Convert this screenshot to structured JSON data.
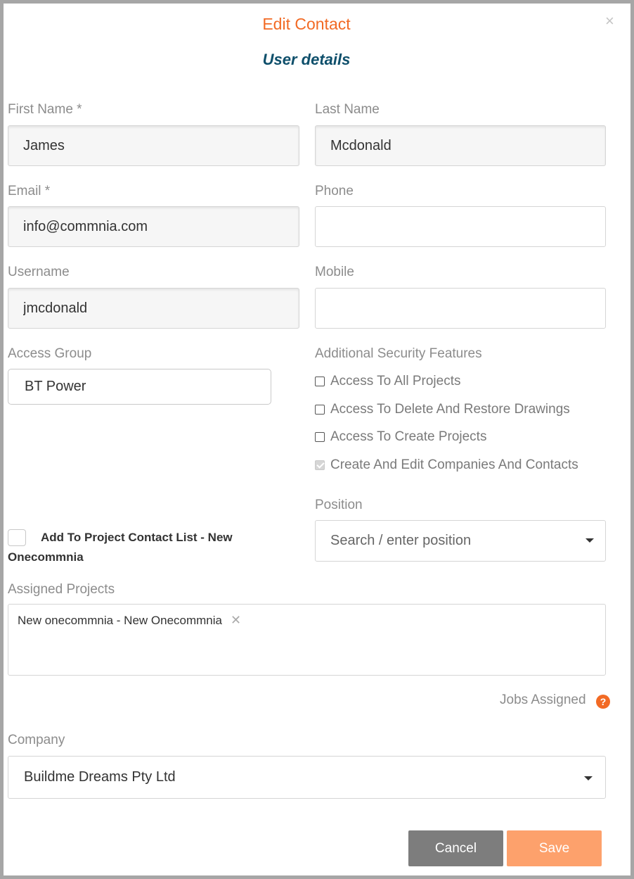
{
  "modal": {
    "title": "Edit Contact",
    "close_icon": "×",
    "subtitle": "User details"
  },
  "form": {
    "first_name": {
      "label": "First Name *",
      "value": "James"
    },
    "last_name": {
      "label": "Last Name",
      "value": "Mcdonald"
    },
    "email": {
      "label": "Email *",
      "value": "info@commnia.com"
    },
    "phone": {
      "label": "Phone",
      "value": ""
    },
    "username": {
      "label": "Username",
      "value": "jmcdonald"
    },
    "mobile": {
      "label": "Mobile",
      "value": ""
    },
    "access_group": {
      "label": "Access Group",
      "value": "BT Power"
    },
    "security": {
      "label": "Additional Security Features",
      "options": [
        {
          "label": "Access To All Projects",
          "checked": false
        },
        {
          "label": "Access To Delete And Restore Drawings",
          "checked": false
        },
        {
          "label": "Access To Create Projects",
          "checked": false
        },
        {
          "label": "Create And Edit Companies And Contacts",
          "checked": true,
          "disabled": true
        }
      ]
    },
    "position": {
      "label": "Position",
      "placeholder": "Search / enter position"
    },
    "add_to_list": {
      "label_line1": "Add To Project Contact List - New",
      "label_line2": "Onecommnia",
      "checked": false
    },
    "assigned_projects": {
      "label": "Assigned Projects",
      "tags": [
        {
          "label": "New onecommnia - New Onecommnia",
          "remove_icon": "✕"
        }
      ]
    },
    "jobs_assigned": {
      "label": "Jobs Assigned",
      "help_icon": "?"
    },
    "company": {
      "label": "Company",
      "value": "Buildme Dreams Pty Ltd"
    }
  },
  "buttons": {
    "cancel": "Cancel",
    "save": "Save"
  },
  "colors": {
    "accent": "#f26a24",
    "subtitle": "#0e4f6b",
    "cancel_bg": "#7d7d7d",
    "save_bg": "#fda16c"
  },
  "icons": {
    "close": "close-icon",
    "dropdown": "chevron-down-icon",
    "remove_tag": "close-icon",
    "help": "question-icon"
  }
}
